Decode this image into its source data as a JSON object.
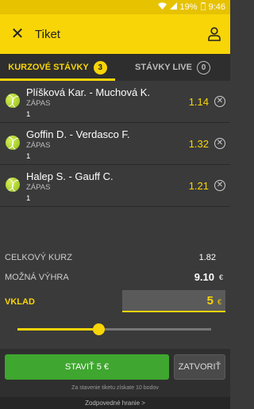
{
  "status_bar": {
    "battery": "19%",
    "time": "9:46"
  },
  "header": {
    "title": "Tiket"
  },
  "tabs": [
    {
      "label": "KURZOVÉ STÁVKY",
      "count": "3",
      "active": true
    },
    {
      "label": "STÁVKY LIVE",
      "count": "0",
      "active": false
    }
  ],
  "bets": [
    {
      "match": "Plíšková Kar. - Muchová K.",
      "market": "ZÁPAS",
      "pick": "1",
      "odd": "1.14"
    },
    {
      "match": "Goffin D. - Verdasco F.",
      "market": "ZÁPAS",
      "pick": "1",
      "odd": "1.32"
    },
    {
      "match": "Halep S. - Gauff C.",
      "market": "ZÁPAS",
      "pick": "1",
      "odd": "1.21"
    }
  ],
  "summary": {
    "total_odds_label": "CELKOVÝ KURZ",
    "total_odds": "1.82",
    "possible_win_label": "MOŽNÁ VÝHRA",
    "possible_win": "9.10",
    "currency": "€",
    "stake_label": "VKLAD",
    "stake": "5"
  },
  "slider": {
    "value_fraction": 0.4
  },
  "actions": {
    "place_label": "STAVIŤ 5 €",
    "close_label": "ZATVORIŤ",
    "note": "Za stavenie tiketu získate 10 bodov"
  },
  "footer_link": "Zodpovedné hranie >"
}
